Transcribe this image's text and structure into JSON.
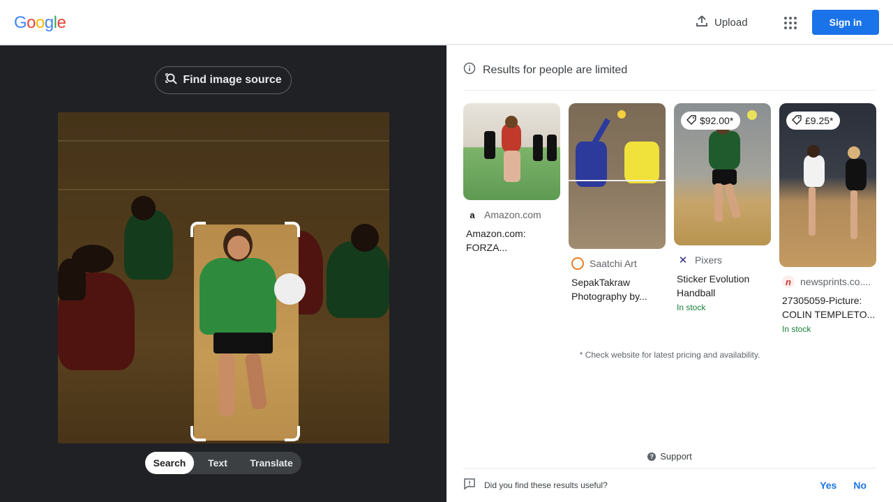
{
  "header": {
    "logo_letters": [
      {
        "ch": "G",
        "color": "#4285f4"
      },
      {
        "ch": "o",
        "color": "#ea4335"
      },
      {
        "ch": "o",
        "color": "#fbbc05"
      },
      {
        "ch": "g",
        "color": "#4285f4"
      },
      {
        "ch": "l",
        "color": "#34a853"
      },
      {
        "ch": "e",
        "color": "#ea4335"
      }
    ],
    "upload_label": "Upload",
    "signin_label": "Sign in",
    "accent": "#1a73e8"
  },
  "left": {
    "find_source_label": "Find image source",
    "modes": [
      "Search",
      "Text",
      "Translate"
    ],
    "active_mode": "Search"
  },
  "right": {
    "notice": "Results for people are limited",
    "results": [
      {
        "source": "Amazon.com",
        "source_icon": "amazon-icon",
        "title_lines": [
          "Amazon.com:",
          "FORZA..."
        ],
        "price": null,
        "stock": null
      },
      {
        "source": "Saatchi Art",
        "source_icon": "saatchi-icon",
        "title_lines": [
          "SepakTakraw",
          "Photography by..."
        ],
        "price": null,
        "stock": null
      },
      {
        "source": "Pixers",
        "source_icon": "pixers-icon",
        "title_lines": [
          "Sticker Evolution",
          "Handball"
        ],
        "price": "$92.00*",
        "stock": "In stock"
      },
      {
        "source": "newsprints.co....",
        "source_icon": "newsprints-icon",
        "title_lines": [
          "27305059-Picture:",
          "COLIN TEMPLETO..."
        ],
        "price": "£9.25*",
        "stock": "In stock"
      }
    ],
    "disclaimer": "* Check website for latest pricing and availability.",
    "support_label": "Support",
    "feedback_question": "Did you find these results useful?",
    "yes_label": "Yes",
    "no_label": "No",
    "stock_color": "#188038"
  }
}
